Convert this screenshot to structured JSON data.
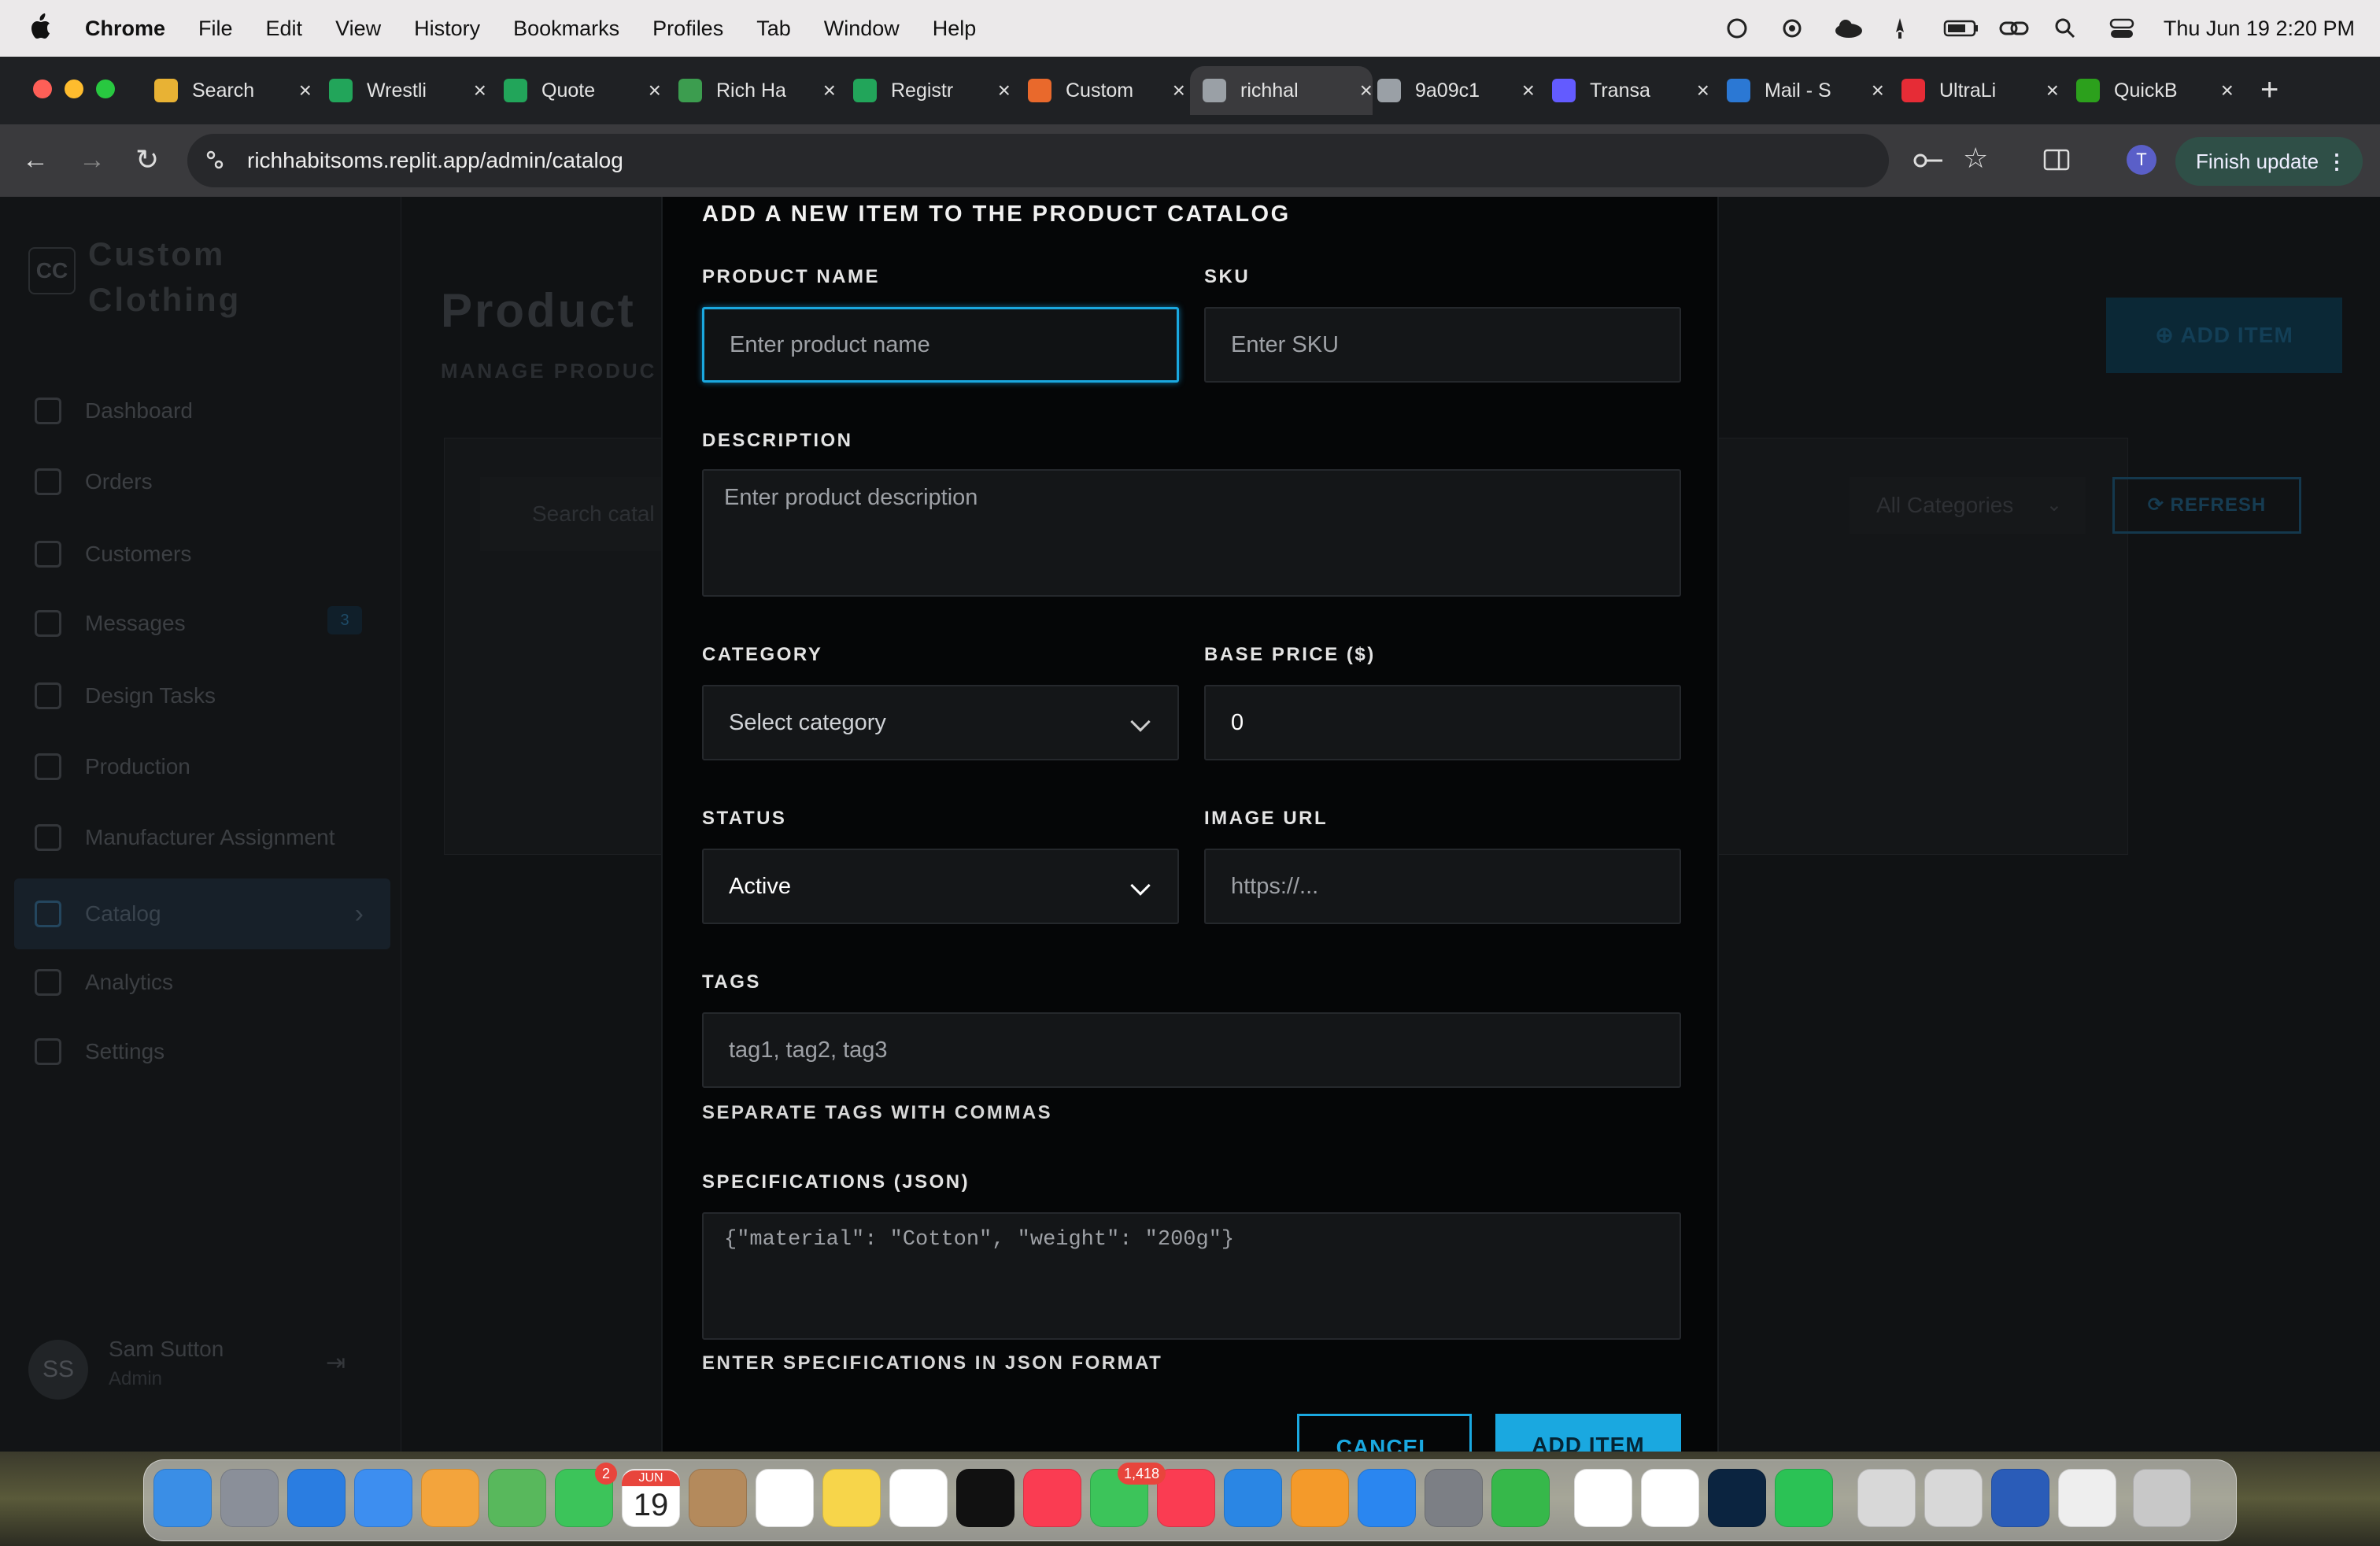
{
  "menubar": {
    "app": "Chrome",
    "items": [
      "File",
      "Edit",
      "View",
      "History",
      "Bookmarks",
      "Profiles",
      "Tab",
      "Window",
      "Help"
    ],
    "datetime": "Thu Jun 19  2:20 PM"
  },
  "tabs": [
    {
      "label": "Search",
      "color": "#e8b234"
    },
    {
      "label": "Wrestli",
      "color": "#22a55a"
    },
    {
      "label": "Quote",
      "color": "#22a55a"
    },
    {
      "label": "Rich Ha",
      "color": "#3c9d4f"
    },
    {
      "label": "Registr",
      "color": "#22a55a"
    },
    {
      "label": "Custom",
      "color": "#e9692c"
    },
    {
      "label": "richhal",
      "color": "#9aa0a6"
    },
    {
      "label": "9a09c1",
      "color": "#9aa0a6"
    },
    {
      "label": "Transa",
      "color": "#635bff"
    },
    {
      "label": "Mail - S",
      "color": "#2b78d4"
    },
    {
      "label": "UltraLi",
      "color": "#e62c36"
    },
    {
      "label": "QuickB",
      "color": "#2ca01c"
    }
  ],
  "browser": {
    "url": "richhabitsoms.replit.app/admin/catalog",
    "profile_initial": "T",
    "finish_update": "Finish update"
  },
  "sidebar": {
    "logo": "CC",
    "brand_line1": "Custom",
    "brand_line2": "Clothing",
    "items": [
      {
        "label": "Dashboard",
        "icon": "home-icon"
      },
      {
        "label": "Orders",
        "icon": "bag-icon"
      },
      {
        "label": "Customers",
        "icon": "users-icon"
      },
      {
        "label": "Messages",
        "icon": "message-icon"
      },
      {
        "label": "Design Tasks",
        "icon": "brush-icon"
      },
      {
        "label": "Production",
        "icon": "factory-icon"
      },
      {
        "label": "Manufacturer Assignment",
        "icon": "user-check-icon"
      },
      {
        "label": "Catalog",
        "icon": "box-icon"
      },
      {
        "label": "Analytics",
        "icon": "bar-chart-icon"
      },
      {
        "label": "Settings",
        "icon": "gear-icon"
      }
    ],
    "messages_badge": "3",
    "user": {
      "initials": "SS",
      "name": "Sam Sutton",
      "role": "Admin"
    }
  },
  "main": {
    "title": "Product",
    "subtitle": "MANAGE PRODUC",
    "add_item": "ADD ITEM",
    "search_placeholder": "Search catal",
    "categories": "All Categories",
    "refresh": "REFRESH"
  },
  "modal": {
    "title": "ADD A NEW ITEM TO THE PRODUCT CATALOG",
    "product_name_label": "PRODUCT NAME",
    "product_name_placeholder": "Enter product name",
    "sku_label": "SKU",
    "sku_placeholder": "Enter SKU",
    "description_label": "DESCRIPTION",
    "description_placeholder": "Enter product description",
    "category_label": "CATEGORY",
    "category_value": "Select category",
    "base_price_label": "BASE PRICE ($)",
    "base_price_value": "0",
    "status_label": "STATUS",
    "status_value": "Active",
    "image_url_label": "IMAGE URL",
    "image_url_placeholder": "https://...",
    "tags_label": "TAGS",
    "tags_placeholder": "tag1, tag2, tag3",
    "tags_hint": "SEPARATE TAGS WITH COMMAS",
    "specs_label": "SPECIFICATIONS (JSON)",
    "specs_placeholder": "{\"material\": \"Cotton\", \"weight\": \"200g\"}",
    "specs_hint": "ENTER SPECIFICATIONS IN JSON FORMAT",
    "cancel": "CANCEL",
    "submit": "ADD ITEM",
    "accent": "#1aa8e0"
  },
  "dock": {
    "calendar_month": "JUN",
    "calendar_day": "19",
    "facetime_badge": "2",
    "messages_badge": "1,418"
  }
}
